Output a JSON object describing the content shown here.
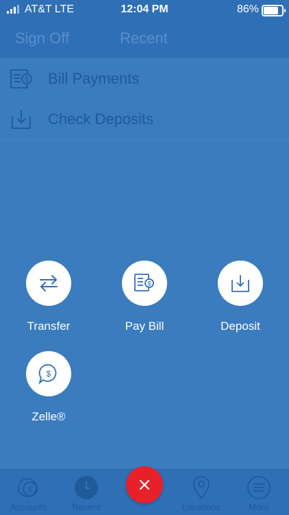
{
  "status_bar": {
    "carrier": "AT&T  LTE",
    "time": "12:04 PM",
    "battery": "86%"
  },
  "nav": {
    "sign_off": "Sign Off",
    "title": "Recent"
  },
  "menu": [
    {
      "label": "Bill Payments",
      "icon": "bill-icon"
    },
    {
      "label": "Check Deposits",
      "icon": "deposit-tray-icon"
    }
  ],
  "actions": [
    {
      "label": "Transfer",
      "icon": "transfer-arrows-icon"
    },
    {
      "label": "Pay Bill",
      "icon": "pay-bill-icon"
    },
    {
      "label": "Deposit",
      "icon": "deposit-icon"
    },
    {
      "label": "Zelle®",
      "icon": "zelle-chat-dollar-icon"
    }
  ],
  "tabs": [
    {
      "label": "Accounts",
      "icon": "accounts-icon"
    },
    {
      "label": "Recent",
      "icon": "clock-icon"
    },
    {
      "label": "Locations",
      "icon": "location-pin-icon"
    },
    {
      "label": "More",
      "icon": "menu-lines-icon"
    }
  ],
  "colors": {
    "overlay_blue": "#3a7cbd",
    "dark_blue": "#1f5a99",
    "close_red": "#e8202a"
  }
}
